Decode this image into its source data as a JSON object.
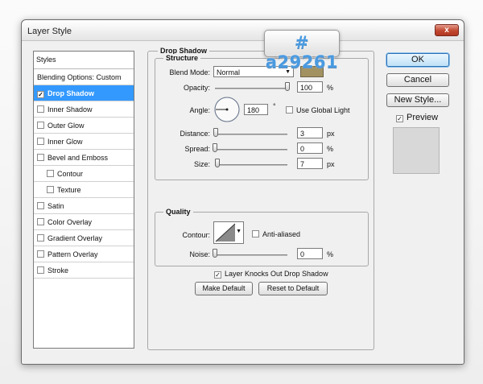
{
  "window": {
    "title": "Layer Style",
    "close_label": "x"
  },
  "annotation": {
    "hex": "# a29261"
  },
  "styles_list": {
    "header": "Styles",
    "blending": "Blending Options: Custom",
    "items": [
      {
        "label": "Drop Shadow",
        "checked": true,
        "selected": true
      },
      {
        "label": "Inner Shadow",
        "checked": false
      },
      {
        "label": "Outer Glow",
        "checked": false
      },
      {
        "label": "Inner Glow",
        "checked": false
      },
      {
        "label": "Bevel and Emboss",
        "checked": false
      },
      {
        "label": "Contour",
        "checked": false,
        "indent": true
      },
      {
        "label": "Texture",
        "checked": false,
        "indent": true
      },
      {
        "label": "Satin",
        "checked": false
      },
      {
        "label": "Color Overlay",
        "checked": false
      },
      {
        "label": "Gradient Overlay",
        "checked": false
      },
      {
        "label": "Pattern Overlay",
        "checked": false
      },
      {
        "label": "Stroke",
        "checked": false
      }
    ]
  },
  "drop_shadow": {
    "title": "Drop Shadow",
    "structure": {
      "title": "Structure",
      "blend_mode_label": "Blend Mode:",
      "blend_mode_value": "Normal",
      "shadow_color": "#a29261",
      "opacity_label": "Opacity:",
      "opacity_value": "100",
      "opacity_unit": "%",
      "opacity_fraction": 1.0,
      "angle_label": "Angle:",
      "angle_value": "180",
      "angle_unit": "°",
      "use_global_light_label": "Use Global Light",
      "use_global_light": false,
      "distance_label": "Distance:",
      "distance_value": "3",
      "distance_unit": "px",
      "distance_fraction": 0.01,
      "spread_label": "Spread:",
      "spread_value": "0",
      "spread_unit": "%",
      "spread_fraction": 0.0,
      "size_label": "Size:",
      "size_value": "7",
      "size_unit": "px",
      "size_fraction": 0.03
    },
    "quality": {
      "title": "Quality",
      "contour_label": "Contour:",
      "anti_aliased_label": "Anti-aliased",
      "anti_aliased": false,
      "noise_label": "Noise:",
      "noise_value": "0",
      "noise_unit": "%",
      "noise_fraction": 0.0
    },
    "knocks_out_label": "Layer Knocks Out Drop Shadow",
    "knocks_out": true,
    "make_default_label": "Make Default",
    "reset_default_label": "Reset to Default"
  },
  "side_buttons": {
    "ok": "OK",
    "cancel": "Cancel",
    "new_style": "New Style...",
    "preview_label": "Preview",
    "preview_checked": true
  }
}
